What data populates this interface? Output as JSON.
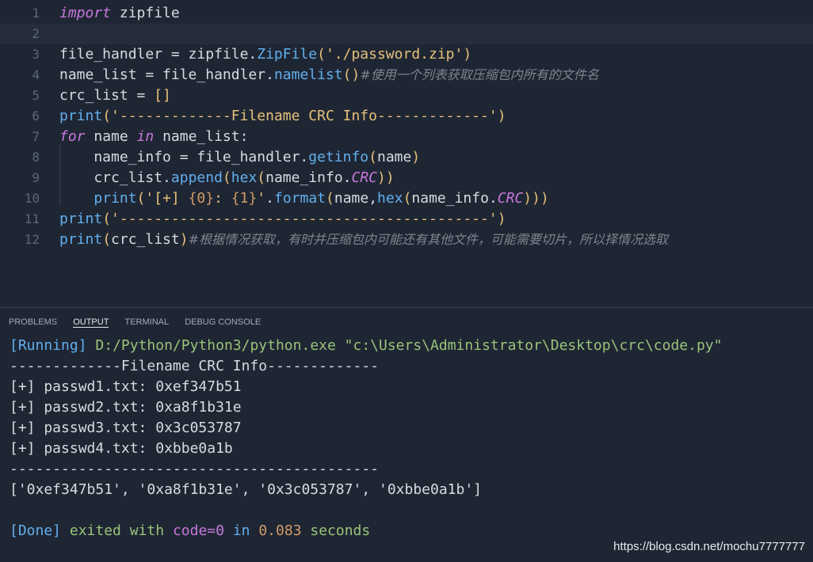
{
  "editor": {
    "lines": [
      {
        "n": "1",
        "tokens": [
          {
            "t": "import",
            "c": "kw"
          },
          {
            "t": " zipfile"
          }
        ]
      },
      {
        "n": "2",
        "tokens": []
      },
      {
        "n": "3",
        "tokens": [
          {
            "t": "file_handler = zipfile."
          },
          {
            "t": "ZipFile",
            "c": "fn"
          },
          {
            "t": "(",
            "c": "br"
          },
          {
            "t": "'./password.zip'",
            "c": "str"
          },
          {
            "t": ")",
            "c": "br"
          }
        ]
      },
      {
        "n": "4",
        "tokens": [
          {
            "t": "name_list = file_handler."
          },
          {
            "t": "namelist",
            "c": "fn"
          },
          {
            "t": "()",
            "c": "br"
          },
          {
            "t": "#使用一个列表获取压缩包内所有的文件名",
            "c": "cm"
          }
        ]
      },
      {
        "n": "5",
        "tokens": [
          {
            "t": "crc_list = "
          },
          {
            "t": "[]",
            "c": "br"
          }
        ]
      },
      {
        "n": "6",
        "tokens": [
          {
            "t": "print",
            "c": "fn"
          },
          {
            "t": "(",
            "c": "br"
          },
          {
            "t": "'-------------Filename CRC Info-------------'",
            "c": "str"
          },
          {
            "t": ")",
            "c": "br"
          }
        ]
      },
      {
        "n": "7",
        "tokens": [
          {
            "t": "for",
            "c": "kw"
          },
          {
            "t": " name "
          },
          {
            "t": "in",
            "c": "kw"
          },
          {
            "t": " name_list:"
          }
        ]
      },
      {
        "n": "8",
        "tokens": [
          {
            "t": "    name_info = file_handler."
          },
          {
            "t": "getinfo",
            "c": "fn"
          },
          {
            "t": "(",
            "c": "br"
          },
          {
            "t": "name"
          },
          {
            "t": ")",
            "c": "br"
          }
        ]
      },
      {
        "n": "9",
        "tokens": [
          {
            "t": "    crc_list."
          },
          {
            "t": "append",
            "c": "fn"
          },
          {
            "t": "(",
            "c": "br"
          },
          {
            "t": "hex",
            "c": "fn"
          },
          {
            "t": "(",
            "c": "br"
          },
          {
            "t": "name_info."
          },
          {
            "t": "CRC",
            "c": "kw"
          },
          {
            "t": "))",
            "c": "br"
          }
        ]
      },
      {
        "n": "10",
        "tokens": [
          {
            "t": "    "
          },
          {
            "t": "print",
            "c": "fn"
          },
          {
            "t": "(",
            "c": "br"
          },
          {
            "t": "'[+] ",
            "c": "str"
          },
          {
            "t": "{0}",
            "c": "num"
          },
          {
            "t": ": ",
            "c": "str"
          },
          {
            "t": "{1}",
            "c": "num"
          },
          {
            "t": "'",
            "c": "str"
          },
          {
            "t": "."
          },
          {
            "t": "format",
            "c": "fn"
          },
          {
            "t": "(",
            "c": "br"
          },
          {
            "t": "name,"
          },
          {
            "t": "hex",
            "c": "fn"
          },
          {
            "t": "(",
            "c": "br"
          },
          {
            "t": "name_info."
          },
          {
            "t": "CRC",
            "c": "kw"
          },
          {
            "t": ")))",
            "c": "br"
          }
        ]
      },
      {
        "n": "11",
        "tokens": [
          {
            "t": "print",
            "c": "fn"
          },
          {
            "t": "(",
            "c": "br"
          },
          {
            "t": "'-------------------------------------------'",
            "c": "str"
          },
          {
            "t": ")",
            "c": "br"
          }
        ]
      },
      {
        "n": "12",
        "tokens": [
          {
            "t": "print",
            "c": "fn"
          },
          {
            "t": "(",
            "c": "br"
          },
          {
            "t": "crc_list"
          },
          {
            "t": ")",
            "c": "br"
          },
          {
            "t": "#根据情况获取，有时并压缩包内可能还有其他文件，可能需要切片，所以择情况选取",
            "c": "cm"
          }
        ]
      }
    ]
  },
  "panel": {
    "tabs": [
      "PROBLEMS",
      "OUTPUT",
      "TERMINAL",
      "DEBUG CONSOLE"
    ],
    "active_tab": "OUTPUT"
  },
  "output": {
    "running_tag": "[Running]",
    "running_cmd": "D:/Python/Python3/python.exe \"c:\\Users\\Administrator\\Desktop\\crc\\code.py\"",
    "header": "-------------Filename CRC Info-------------",
    "rows": [
      "[+] passwd1.txt: 0xef347b51",
      "[+] passwd2.txt: 0xa8f1b31e",
      "[+] passwd3.txt: 0x3c053787",
      "[+] passwd4.txt: 0xbbe0a1b"
    ],
    "separator": "-------------------------------------------",
    "list": "['0xef347b51', '0xa8f1b31e', '0x3c053787', '0xbbe0a1b']",
    "done_tag": "[Done]",
    "done_text": "exited with",
    "done_code": "code=0",
    "done_in": "in",
    "done_secs": "0.083",
    "done_seconds": "seconds"
  },
  "watermark": "https://blog.csdn.net/mochu7777777"
}
